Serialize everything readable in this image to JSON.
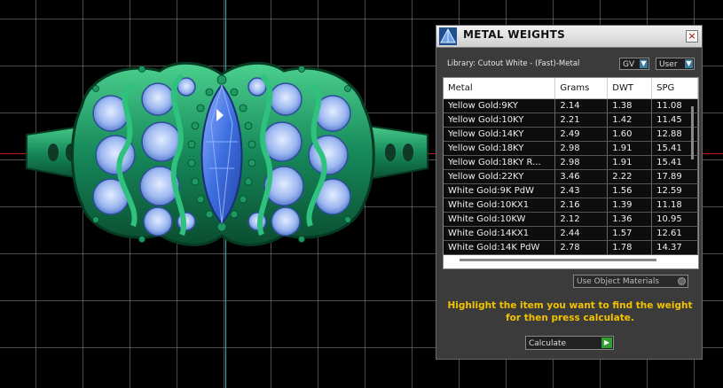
{
  "panel": {
    "title": "METAL WEIGHTS",
    "close_glyph": "×",
    "library_label": "Library: Cutout White - (Fast)-Metal",
    "gv_label": "GV",
    "user_label": "User",
    "use_object_materials": "Use Object Materials",
    "hint": "Highlight the item you want to find the weight for then press calculate.",
    "calculate_label": "Calculate",
    "dropdown_arrow_glyph": "▼",
    "go_arrow_glyph": "▶"
  },
  "table": {
    "headers": [
      "Metal",
      "Grams",
      "DWT",
      "SPG"
    ],
    "rows": [
      [
        "Yellow Gold:9KY",
        "2.14",
        "1.38",
        "11.08"
      ],
      [
        "Yellow Gold:10KY",
        "2.21",
        "1.42",
        "11.45"
      ],
      [
        "Yellow Gold:14KY",
        "2.49",
        "1.60",
        "12.88"
      ],
      [
        "Yellow Gold:18KY",
        "2.98",
        "1.91",
        "15.41"
      ],
      [
        "Yellow Gold:18KY R...",
        "2.98",
        "1.91",
        "15.41"
      ],
      [
        "Yellow Gold:22KY",
        "3.46",
        "2.22",
        "17.89"
      ],
      [
        "White Gold:9K PdW",
        "2.43",
        "1.56",
        "12.59"
      ],
      [
        "White Gold:10KX1",
        "2.16",
        "1.39",
        "11.18"
      ],
      [
        "White Gold:10KW",
        "2.12",
        "1.36",
        "10.95"
      ],
      [
        "White Gold:14KX1",
        "2.44",
        "1.57",
        "12.61"
      ],
      [
        "White Gold:14K PdW",
        "2.78",
        "1.78",
        "14.37"
      ]
    ]
  },
  "colors": {
    "accent_yellow": "#f2c300",
    "metal_green": "#1f8a5a",
    "gem_blue": "#4a7fe0",
    "axis_cyan": "#1fb5b5",
    "axis_red": "#c01515"
  },
  "icons": {
    "app": "pyramid-logo-icon",
    "close": "close-icon",
    "dropdown": "dropdown-arrow-icon",
    "go": "go-arrow-icon"
  }
}
